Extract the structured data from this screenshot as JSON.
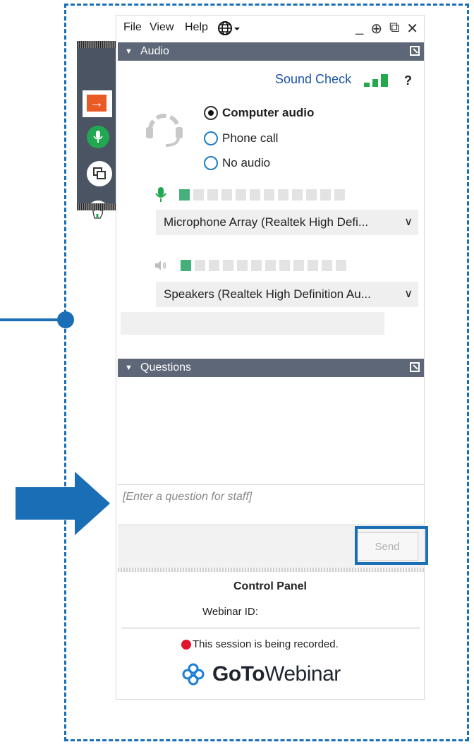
{
  "menu": {
    "file": "File",
    "view": "View",
    "help": "Help"
  },
  "window_controls": [
    "_",
    "⊕",
    "⧉",
    "✕"
  ],
  "audio": {
    "header": "Audio",
    "sound_check": "Sound Check",
    "help": "?",
    "options": [
      {
        "label": "Computer audio",
        "selected": true
      },
      {
        "label": "Phone call",
        "selected": false
      },
      {
        "label": "No audio",
        "selected": false
      }
    ],
    "mic_level": {
      "lit_cells": 1,
      "total_cells": 12
    },
    "speaker_level": {
      "lit_cells": 1,
      "total_cells": 12
    },
    "microphone": "Microphone Array (Realtek High Defi...",
    "speakers": "Speakers (Realtek High Definition Au..."
  },
  "questions": {
    "header": "Questions",
    "placeholder": "[Enter a question for staff]",
    "send_label": "Send"
  },
  "footer": {
    "title": "Control Panel",
    "webinar_id_label": "Webinar ID:",
    "recording_text": "This session is being recorded.",
    "brand_bold": "GoTo",
    "brand_light": "Webinar"
  },
  "colors": {
    "callout_blue": "#1a6eb5",
    "header_gray": "#5d6777",
    "mic_green": "#22a852",
    "exit_orange": "#ea5a25",
    "record_red": "#e0172c"
  },
  "icons": [
    "exit-icon",
    "microphone-icon",
    "screen-share-icon",
    "raise-hand-icon",
    "globe-icon",
    "headset-icon",
    "speaker-icon",
    "popout-icon",
    "gotowebinar-logo-icon"
  ]
}
